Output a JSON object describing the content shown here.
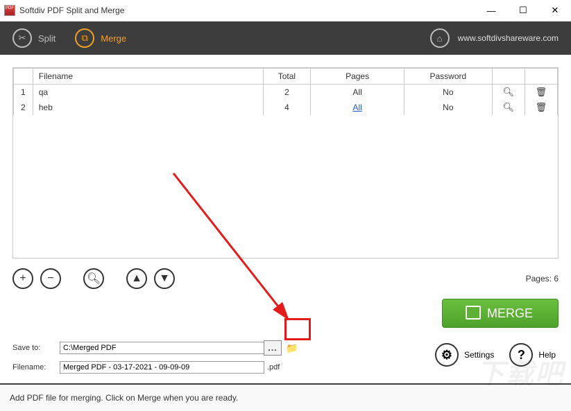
{
  "window": {
    "title": "Softdiv PDF Split and Merge"
  },
  "toolbar": {
    "split": "Split",
    "merge": "Merge",
    "site": "www.softdivshareware.com"
  },
  "grid": {
    "headers": {
      "num": "",
      "file": "Filename",
      "total": "Total",
      "pages": "Pages",
      "password": "Password"
    },
    "rows": [
      {
        "num": "1",
        "file": "qa",
        "total": "2",
        "pages": "All",
        "password": "No",
        "pages_link": false
      },
      {
        "num": "2",
        "file": "heb",
        "total": "4",
        "pages": "All",
        "password": "No",
        "pages_link": true
      }
    ]
  },
  "pages_label": "Pages: 6",
  "merge_btn": "MERGE",
  "save": {
    "label": "Save to:",
    "value": "C:\\Merged PDF"
  },
  "filename": {
    "label": "Filename:",
    "value": "Merged PDF - 03-17-2021 - 09-09-09",
    "ext": ".pdf"
  },
  "settings": "Settings",
  "help": "Help",
  "status": "Add PDF file for merging. Click on Merge when you are ready."
}
